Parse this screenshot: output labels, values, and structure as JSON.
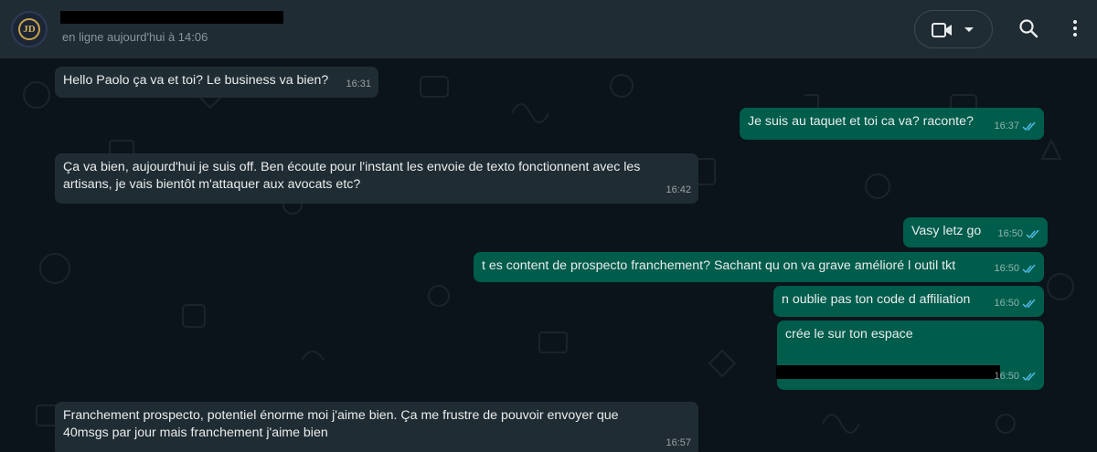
{
  "header": {
    "status": "en ligne aujourd'hui à 14:06",
    "avatar_text": "JD"
  },
  "messages": [
    {
      "dir": "in",
      "text": "Hello Paolo ça va et toi? Le business va bien?",
      "time": "16:31"
    },
    {
      "dir": "out",
      "text": "Je suis au taquet et toi ca va? raconte?",
      "time": "16:37",
      "status": "read"
    },
    {
      "dir": "in",
      "text": "Ça va bien, aujourd'hui je suis off. Ben écoute pour l'instant les envoie de texto fonctionnent avec les artisans, je vais bientôt m'attaquer aux avocats etc?",
      "time": "16:42"
    },
    {
      "dir": "out",
      "text": "Vasy letz go",
      "time": "16:50",
      "status": "read"
    },
    {
      "dir": "out",
      "text": "t es content de prospecto franchement? Sachant qu on va grave amélioré l outil tkt",
      "time": "16:50",
      "status": "read"
    },
    {
      "dir": "out",
      "text": "n oublie pas ton code d affiliation",
      "time": "16:50",
      "status": "read"
    },
    {
      "dir": "out",
      "text": "crée le sur ton espace",
      "time": "16:50",
      "status": "read"
    },
    {
      "dir": "in",
      "text": "Franchement prospecto, potentiel énorme moi j'aime bien. Ça me frustre de pouvoir envoyer que 40msgs par jour mais franchement j'aime bien",
      "time": "16:57"
    }
  ],
  "colors": {
    "incoming_bubble": "#202c33",
    "outgoing_bubble": "#005c4b",
    "read_ticks": "#53bdeb",
    "background": "#0b141a"
  },
  "icons": {
    "video": "video-camera-icon",
    "dropdown": "chevron-down-icon",
    "search": "search-icon",
    "menu": "kebab-menu-icon"
  }
}
